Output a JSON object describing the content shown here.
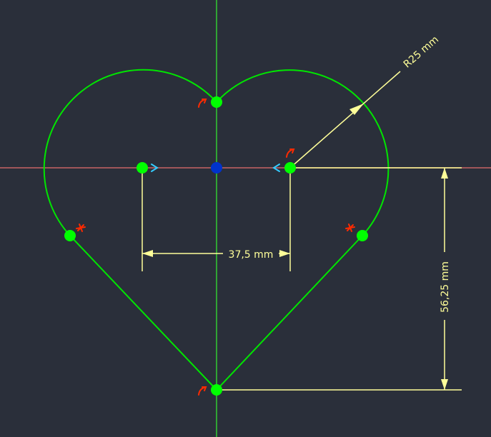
{
  "viewport": {
    "background_color": "#2a2f3a"
  },
  "colors": {
    "geometry": "#00e600",
    "vertex": "#00ff00",
    "origin": "#0033cc",
    "axis_horizontal": "#c86464",
    "axis_vertical": "#33cc33",
    "dimension": "#ffff99",
    "constraint_tangent": "#ff2a00",
    "constraint_arrow": "#33ccff"
  },
  "dimensions": {
    "radius_label": "R25 mm",
    "horizontal_label": "37,5 mm",
    "vertical_label": "56,25 mm"
  },
  "constraint_icons": [
    "tangent-constraint-icon",
    "tangent-constraint-icon",
    "tangent-constraint-icon",
    "point-on-object-constraint-icon",
    "point-on-object-constraint-icon",
    "horizontal-direction-arrow-icon",
    "horizontal-direction-arrow-icon"
  ]
}
